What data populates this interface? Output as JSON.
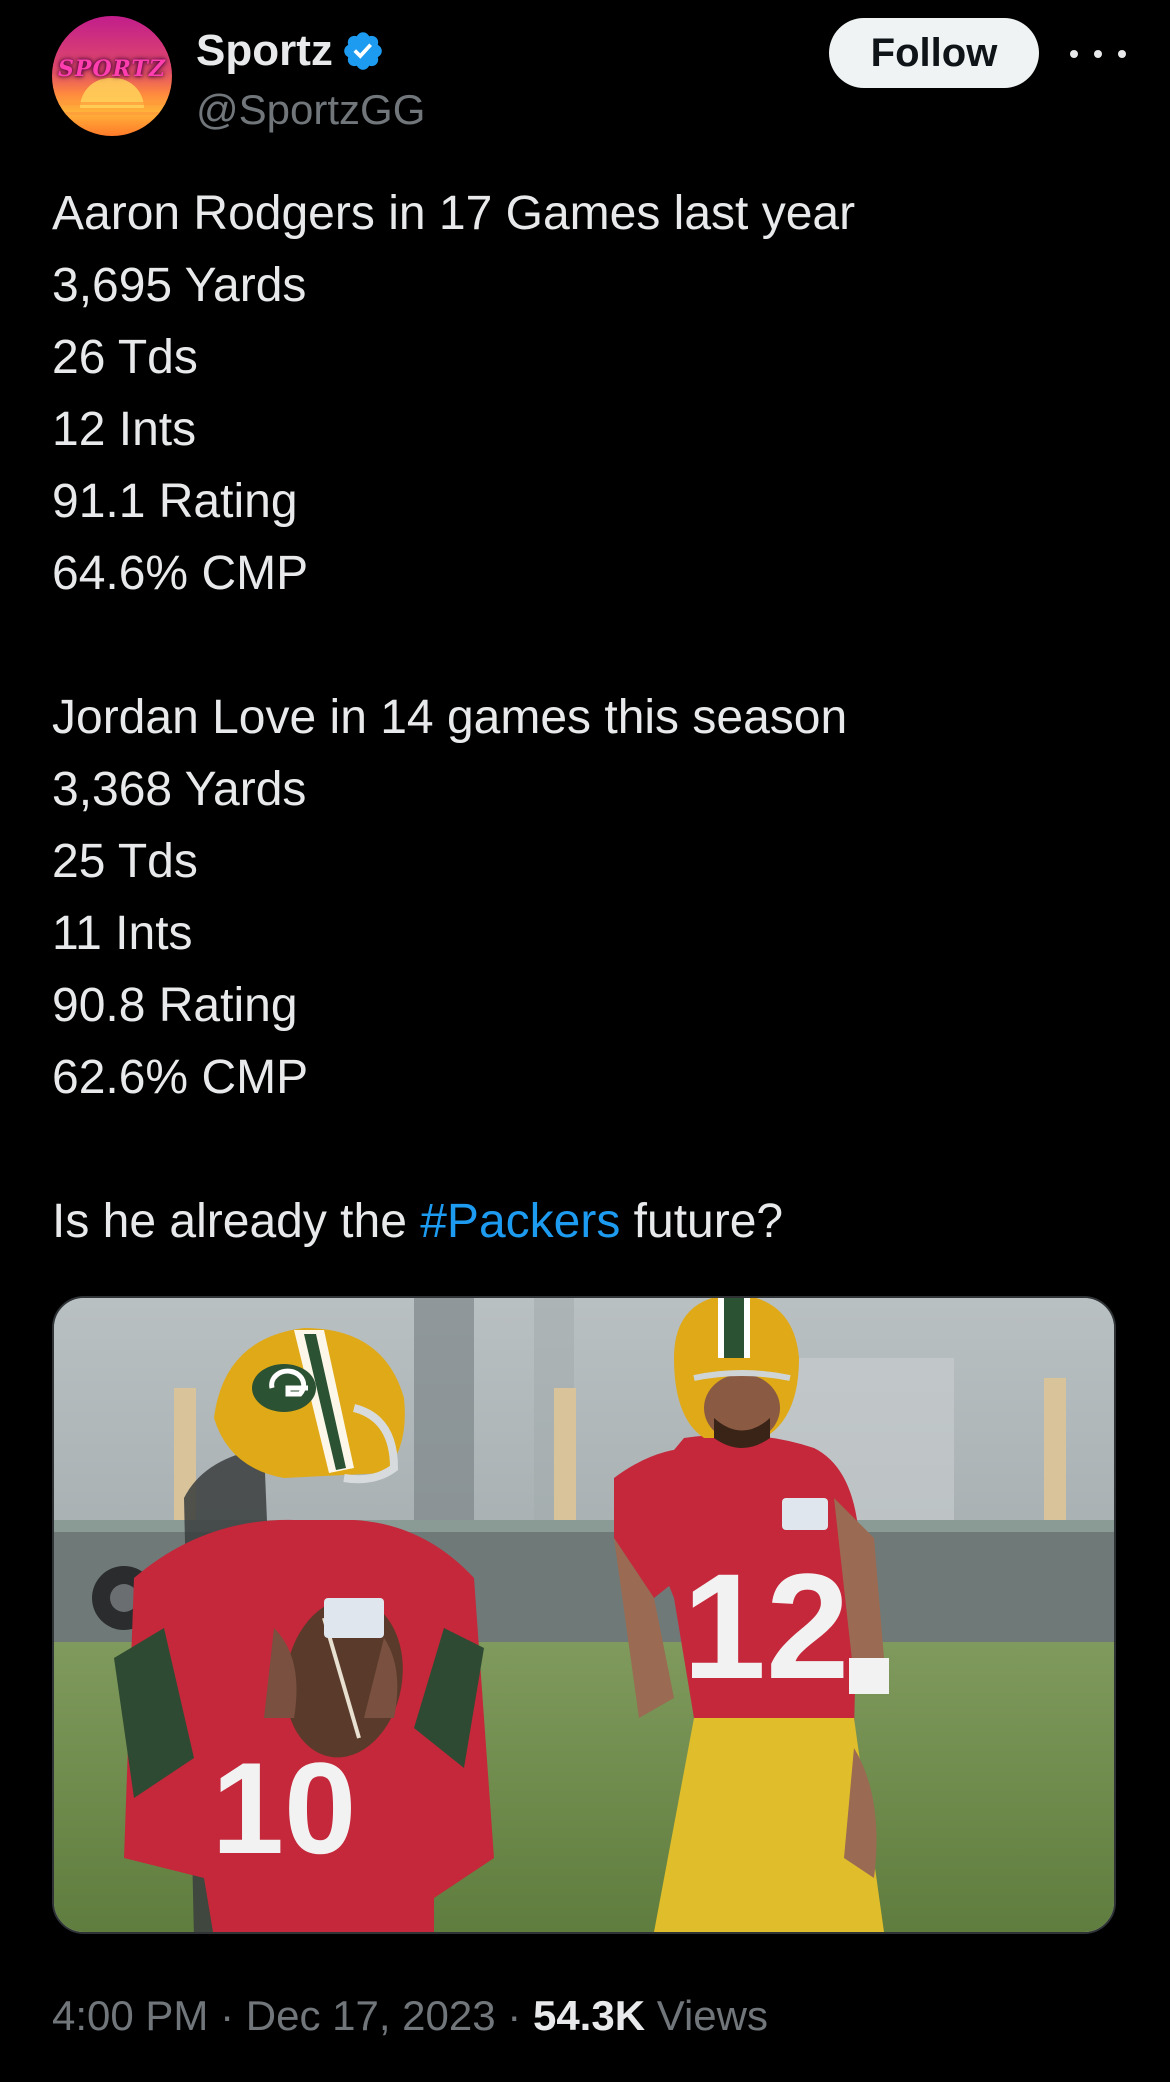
{
  "author": {
    "name": "Sportz",
    "handle": "@SportzGG",
    "avatar_text": "SPORTZ",
    "verified": true
  },
  "actions": {
    "follow_label": "Follow"
  },
  "tweet": {
    "lines": [
      "Aaron Rodgers in 17 Games last year",
      "3,695 Yards",
      "26 Tds",
      "12 Ints",
      "91.1 Rating",
      "64.6% CMP",
      "",
      "Jordan Love in 14 games this season",
      "3,368 Yards",
      "25 Tds",
      "11 Ints",
      "90.8 Rating",
      "62.6% CMP",
      ""
    ],
    "question_prefix": "Is he already the ",
    "hashtag": "#Packers",
    "question_suffix": " future?"
  },
  "media": {
    "left_jersey_number": "10",
    "right_jersey_number": "12"
  },
  "meta": {
    "time": "4:00 PM",
    "date": "Dec 17, 2023",
    "views_count": "54.3K",
    "views_label": "Views",
    "separator": "·"
  },
  "colors": {
    "background": "#000000",
    "text": "#e7e9ea",
    "secondary": "#71767b",
    "link": "#1d9bf0",
    "verified": "#1d9bf0"
  }
}
